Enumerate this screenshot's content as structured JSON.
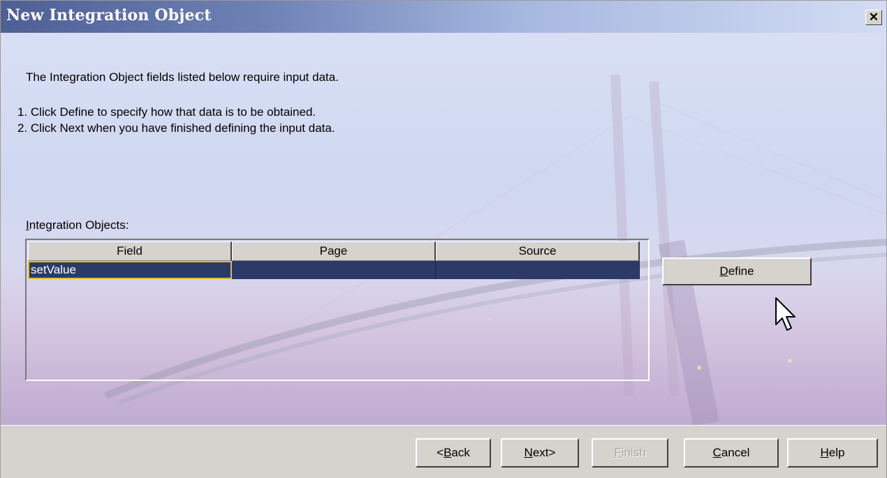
{
  "window": {
    "title": "New Integration Object",
    "close_label": "✕"
  },
  "instructions": {
    "line1": "The Integration Object fields listed below require input data.",
    "line2": "1. Click Define to specify how that data is to be obtained.",
    "line3": "2. Click Next when you have finished defining the input data."
  },
  "objects_label": {
    "first_letter": "I",
    "rest": "ntegration Objects:"
  },
  "table": {
    "columns": [
      "Field",
      "Page",
      "Source"
    ],
    "rows": [
      {
        "field": "setValue",
        "page": "",
        "source": ""
      }
    ]
  },
  "define_button": {
    "underlined": "D",
    "rest": "efine"
  },
  "buttons": {
    "back": {
      "pre": "<",
      "underlined": "B",
      "rest": "ack"
    },
    "next": {
      "pre": "",
      "underlined": "N",
      "rest": "ext>"
    },
    "finish": {
      "pre": "",
      "underlined": "F",
      "rest": "inish"
    },
    "cancel": {
      "pre": "",
      "underlined": "C",
      "rest": "ancel"
    },
    "help": {
      "pre": "",
      "underlined": "H",
      "rest": "elp"
    }
  },
  "colors": {
    "selection": "#2b3a66",
    "focus_border": "#d9c13b",
    "titlebar_start": "#4d5f95"
  }
}
